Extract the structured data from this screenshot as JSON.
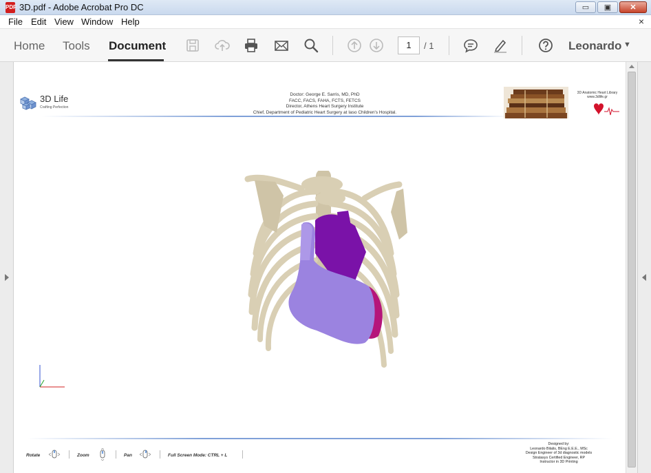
{
  "window": {
    "title": "3D.pdf - Adobe Acrobat Pro DC",
    "file_icon_label": "PDF",
    "minimize_glyph": "▭",
    "maximize_glyph": "▣",
    "close_glyph": "✕"
  },
  "menu": {
    "items": [
      "File",
      "Edit",
      "View",
      "Window",
      "Help"
    ],
    "close_doc_glyph": "×"
  },
  "toolbar": {
    "tabs": [
      {
        "label": "Home",
        "active": false
      },
      {
        "label": "Tools",
        "active": false
      },
      {
        "label": "Document",
        "active": true
      }
    ],
    "icons": [
      "save-icon",
      "upload-icon",
      "print-icon",
      "email-icon",
      "search-icon",
      "page-up-icon",
      "page-down-icon",
      "comment-icon",
      "sign-icon",
      "help-icon"
    ],
    "page_current": "1",
    "page_total": "/ 1",
    "user_name": "Leonardo",
    "user_caret": "▼"
  },
  "document": {
    "logo": {
      "name": "3D Life",
      "tagline": "Crafting Perfection"
    },
    "doctor_lines": [
      "Doctor: George E. Sarris, MD, PhD",
      "FACC, FACS, FAHA, FCTS, FETCS",
      "Director, Athens Heart Surgery Institute",
      "Chief, Department of Pediatric Heart Surgery at Iaso Children's Hospital."
    ],
    "library": {
      "title": "3D Anatomic Heart Library",
      "url": "www.3dlife.gr"
    },
    "controls": [
      {
        "label": "Rotate"
      },
      {
        "label": "Zoom"
      },
      {
        "label": "Pan"
      },
      {
        "label": "Full Screen Mode:  CTRL + L"
      }
    ],
    "credits": [
      "Designed by:",
      "Leonardo Bilalis, BEng E.E.E., MSc",
      "Design Engineer of 3d diagnostic models",
      "Stratasys Certified Engineer, RP",
      "Instructor in 3D Printing"
    ]
  },
  "colors": {
    "bone": "#d9cfb4",
    "heart_violet": "#7a12a8",
    "heart_lavender": "#9b83e0",
    "heart_magenta": "#b5157a",
    "accent_rule": "#7fa0d8"
  }
}
